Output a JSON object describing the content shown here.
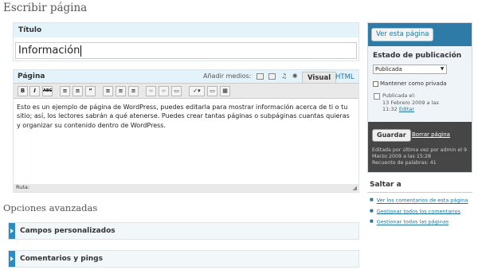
{
  "page": {
    "title": "Escribir página"
  },
  "title_box": {
    "label": "Título",
    "value": "Información"
  },
  "editor": {
    "label": "Página",
    "media_label": "Añadir medios:",
    "tabs": {
      "visual": "Visual",
      "html": "HTML"
    },
    "toolbar": {
      "bold": "B",
      "italic": "I",
      "strike": "ABC",
      "ul": "≡",
      "ol": "≡",
      "quote": "“",
      "align_left": "≡",
      "align_center": "≡",
      "align_right": "≡",
      "link": "∞",
      "unlink": "∞",
      "more": "▭",
      "spell": "✓▾",
      "fullscreen": "▭",
      "kitchen": "▦"
    },
    "content": "Esto es un ejemplo de página de WordPress, puedes editarla para mostrar información acerca de ti o tu sitio; así, los lectores sabrán a qué atenerse. Puedes crear tantas páginas o subpáginas cuantas quieras y organizar su contenido dentro de WordPress.",
    "path_label": "Ruta:"
  },
  "advanced": {
    "title": "Opciones avanzadas",
    "boxes": [
      {
        "label": "Campos personalizados"
      },
      {
        "label": "Comentarios y pings"
      }
    ]
  },
  "sidebar": {
    "view_button": "Ver esta página",
    "estado_title": "Estado de publicación",
    "status_select": "Publicada",
    "private_label": "Mantener como privada",
    "published_label": "Publicada el:",
    "published_date": "13 Febrero 2009 a las",
    "published_time": "11:32",
    "edit_link": "Editar",
    "save_button": "Guardar",
    "delete_link": "Borrar página",
    "edited_line1": "Editada por última vez por admin el 9",
    "edited_line2": "Marzo 2009 a las 15:28",
    "word_count": "Recuento de palabras: 41"
  },
  "saltar": {
    "title": "Saltar a",
    "links": [
      "Ver los comentarios de esta página",
      "Gestionar todos los comentarios",
      "Gestionar todas las páginas"
    ]
  }
}
